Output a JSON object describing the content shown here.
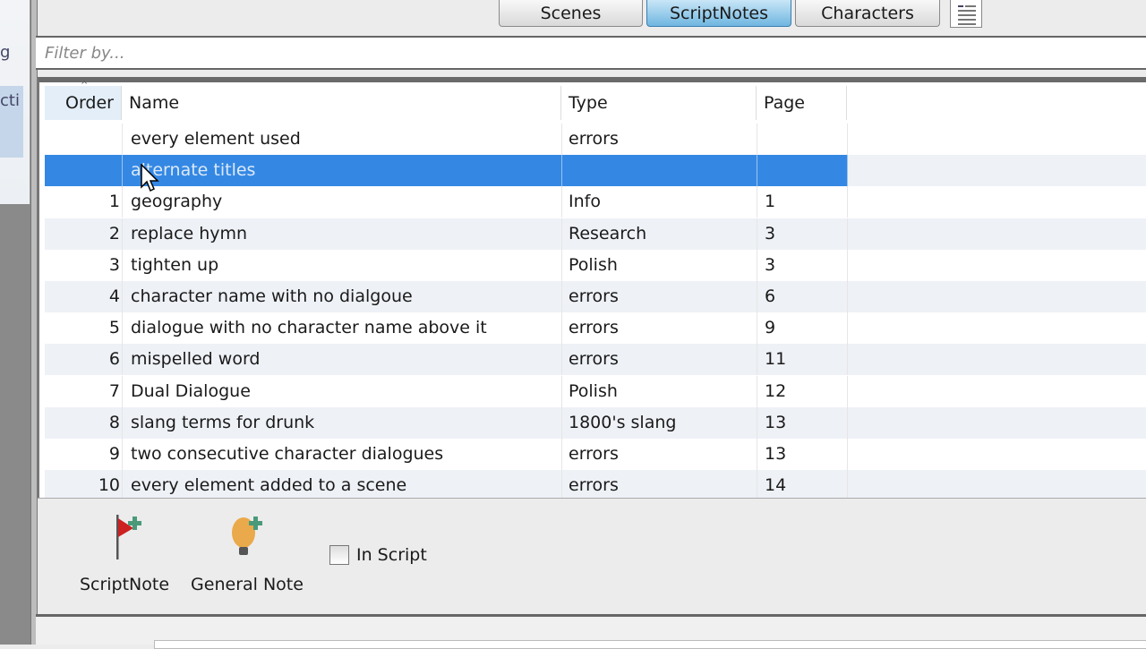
{
  "background_window": {
    "fragments": [
      "g",
      "cti"
    ]
  },
  "tabs": [
    {
      "label": "Scenes",
      "active": false
    },
    {
      "label": "ScriptNotes",
      "active": true
    },
    {
      "label": "Characters",
      "active": false
    }
  ],
  "list_view_icon": "list-icon",
  "filter": {
    "placeholder": "Filter by...",
    "value": ""
  },
  "table": {
    "columns": [
      "Order",
      "Name",
      "Type",
      "Page"
    ],
    "sorted_column": "Order",
    "selected_color": "#3488e4",
    "rows": [
      {
        "order": "",
        "name": "every element used",
        "type": "errors",
        "page": ""
      },
      {
        "order": "",
        "name": "alternate titles",
        "type": "",
        "page": "",
        "selected": true
      },
      {
        "order": "1",
        "name": "geography",
        "type": "Info",
        "page": "1"
      },
      {
        "order": "2",
        "name": "replace hymn",
        "type": "Research",
        "page": "3"
      },
      {
        "order": "3",
        "name": "tighten up",
        "type": "Polish",
        "page": "3"
      },
      {
        "order": "4",
        "name": "character name with no dialgoue",
        "type": "errors",
        "page": "6"
      },
      {
        "order": "5",
        "name": "dialogue with no character name above it",
        "type": "errors",
        "page": "9"
      },
      {
        "order": "6",
        "name": "mispelled word",
        "type": "errors",
        "page": "11"
      },
      {
        "order": "7",
        "name": "Dual Dialogue",
        "type": "Polish",
        "page": "12"
      },
      {
        "order": "8",
        "name": "slang terms for drunk",
        "type": "1800's slang",
        "page": "13"
      },
      {
        "order": "9",
        "name": "two consecutive character dialogues",
        "type": "errors",
        "page": "13"
      },
      {
        "order": "10",
        "name": "every element added to a scene",
        "type": "errors",
        "page": "14"
      }
    ]
  },
  "toolbar": {
    "scriptnote_label": "ScriptNote",
    "general_note_label": "General Note",
    "in_script_label": "In Script",
    "in_script_checked": false
  }
}
